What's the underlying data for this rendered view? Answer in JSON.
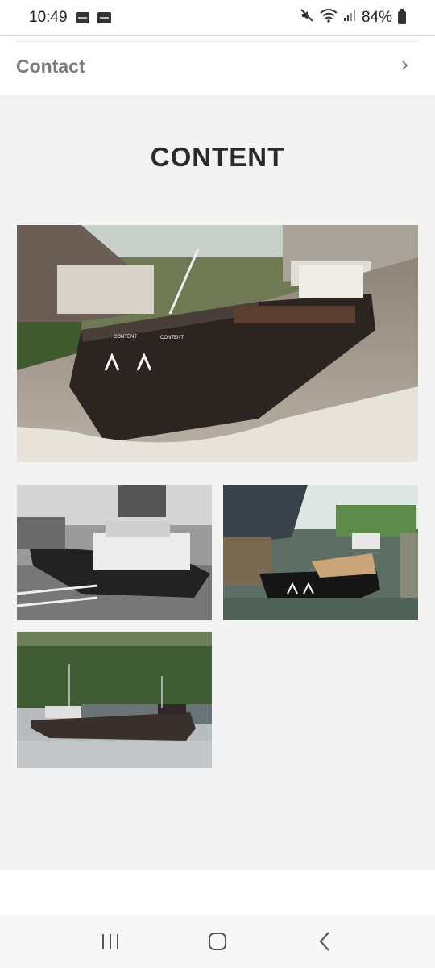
{
  "status_bar": {
    "time": "10:49",
    "battery": "84%",
    "icons": [
      "notification-icon",
      "notification-icon",
      "mute-icon",
      "wifi-icon",
      "signal-icon",
      "battery-icon"
    ]
  },
  "nav": {
    "contact_label": "Contact"
  },
  "main": {
    "title": "CONTENT"
  },
  "gallery": {
    "images": [
      {
        "name": "barge-content-canal-photo",
        "caption": "CONTENT"
      },
      {
        "name": "barge-bw-photo",
        "caption": ""
      },
      {
        "name": "barge-lock-photo",
        "caption": ""
      },
      {
        "name": "barge-river-photo",
        "caption": ""
      }
    ]
  },
  "system_nav": {
    "buttons": [
      "recent-apps",
      "home",
      "back"
    ]
  }
}
